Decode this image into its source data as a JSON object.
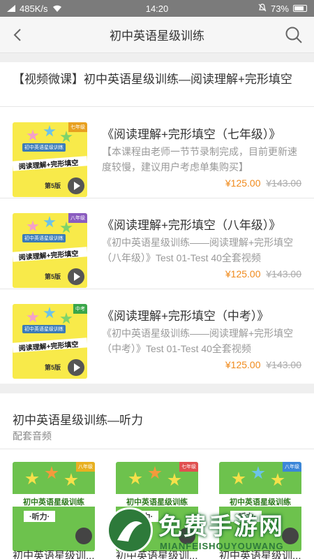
{
  "status_bar": {
    "network_speed": "485K/s",
    "time": "14:20",
    "battery": "73%"
  },
  "nav": {
    "title": "初中英语星级训练"
  },
  "section1": {
    "heading": "【视频微课】初中英语星级训练—阅读理解+完形填空",
    "items": [
      {
        "title": "《阅读理解+完形填空（七年级）》",
        "desc": "【本课程由老师一节节录制完成，目前更新速度较慢，建议用户考虑单集购买】",
        "price": "¥125.00",
        "original_price": "¥143.00",
        "cover_series": "初中英语星级训练",
        "cover_main": "阅读理解+完形填空",
        "cover_grade": "七年级",
        "cover_vol": "第5版"
      },
      {
        "title": "《阅读理解+完形填空（八年级）》",
        "desc": "《初中英语星级训练——阅读理解+完形填空（八年级）》Test 01-Test 40全套视频",
        "price": "¥125.00",
        "original_price": "¥143.00",
        "cover_series": "初中英语星级训练",
        "cover_main": "阅读理解+完形填空",
        "cover_grade": "八年级",
        "cover_vol": "第5版"
      },
      {
        "title": "《阅读理解+完形填空（中考）》",
        "desc": "《初中英语星级训练——阅读理解+完形填空（中考）》Test 01-Test 40全套视频",
        "price": "¥125.00",
        "original_price": "¥143.00",
        "cover_series": "初中英语星级训练",
        "cover_main": "阅读理解+完形填空",
        "cover_grade": "中考",
        "cover_vol": "第5版"
      }
    ]
  },
  "section2": {
    "title": "初中英语星级训练—听力",
    "subtitle": "配套音频",
    "items": [
      {
        "caption": "初中英语星级训...",
        "cover_title": "初中英语星级训练",
        "cover_listen": "·听力·",
        "cover_grade": "八年级"
      },
      {
        "caption": "初中英语星级训...",
        "cover_title": "初中英语星级训练",
        "cover_listen": "·听力·",
        "cover_grade": "七年级"
      },
      {
        "caption": "初中英语星级训...",
        "cover_title": "初中英语星级训练",
        "cover_listen": "·听力·",
        "cover_grade": "八年级"
      }
    ]
  },
  "watermark": {
    "text": "免费手游网",
    "sub": "MIANFEISHOUYOUWANG"
  },
  "colors": {
    "price": "#f08a1b",
    "status_bar": "#7b7b7b",
    "cover_yellow": "#f8ea4a",
    "cover_green": "#6dc24d"
  }
}
